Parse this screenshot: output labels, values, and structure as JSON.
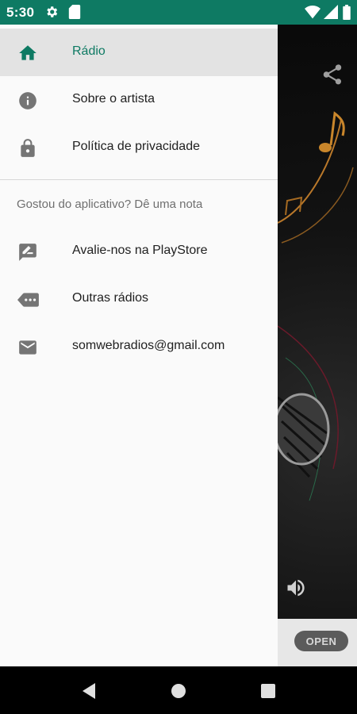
{
  "status_bar": {
    "time": "5:30",
    "icons": [
      "gear-icon",
      "sd-card-icon",
      "wifi-icon",
      "cell-signal-icon",
      "battery-icon"
    ]
  },
  "drawer": {
    "items": [
      {
        "label": "Rádio",
        "icon": "home-icon",
        "active": true
      },
      {
        "label": "Sobre o artista",
        "icon": "info-icon",
        "active": false
      },
      {
        "label": "Política de privacidade",
        "icon": "lock-icon",
        "active": false
      }
    ],
    "section_header": "Gostou do aplicativo? Dê uma nota",
    "section_items": [
      {
        "label": "Avalie-nos na PlayStore",
        "icon": "rate-review-icon"
      },
      {
        "label": "Outras rádios",
        "icon": "more-label-icon"
      },
      {
        "label": "somwebradios@gmail.com",
        "icon": "email-icon"
      }
    ]
  },
  "background_app": {
    "ad_button_label": "OPEN",
    "icons": [
      "share-icon",
      "volume-icon"
    ]
  },
  "navigation_bar": {
    "buttons": [
      "back-icon",
      "home-circle-icon",
      "recents-icon"
    ]
  },
  "colors": {
    "status_bar": "#0e7a63",
    "accent": "#0e7a63",
    "icon_gray": "#757575",
    "active_item_bg": "#e3e3e3"
  }
}
